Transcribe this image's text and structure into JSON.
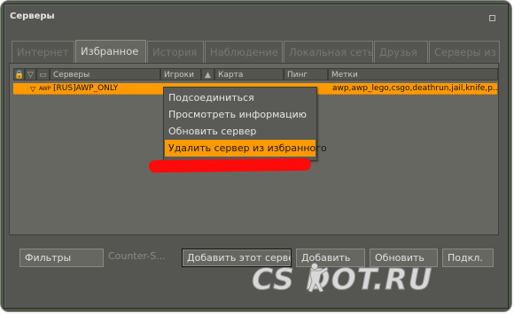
{
  "window": {
    "title": "Серверы"
  },
  "tabs": [
    {
      "label": "Интернет"
    },
    {
      "label": "Избранное"
    },
    {
      "label": "История"
    },
    {
      "label": "Наблюдение"
    },
    {
      "label": "Локальная сеть"
    },
    {
      "label": "Друзья"
    },
    {
      "label": "Серверы из ч"
    }
  ],
  "columns": {
    "servers": "Серверы",
    "players": "Игроки",
    "map": "Карта",
    "ping": "Пинг",
    "tags": "Метки"
  },
  "server_row": {
    "badge": "AWP",
    "name": "[RUS]AWP_ONLY",
    "tags": "awp,awp_lego,csgo,deathrun,jail,knife,p..."
  },
  "context_menu": {
    "items": [
      {
        "label": "Подсоединиться"
      },
      {
        "label": "Просмотреть информацию"
      },
      {
        "label": "Обновить сервер"
      },
      {
        "label": "Удалить сервер из избранного"
      }
    ]
  },
  "footer": {
    "filters": "Фильтры",
    "game": "Counter-S...",
    "add_this_server": "Добавить этот сервер",
    "add": "Добавить",
    "refresh": "Обновить",
    "connect": "Подкл."
  },
  "watermark": "CSDOT.RU",
  "colors": {
    "accent": "#fe9a00",
    "scribble": "#ff0a0a",
    "panel": "#676762"
  }
}
